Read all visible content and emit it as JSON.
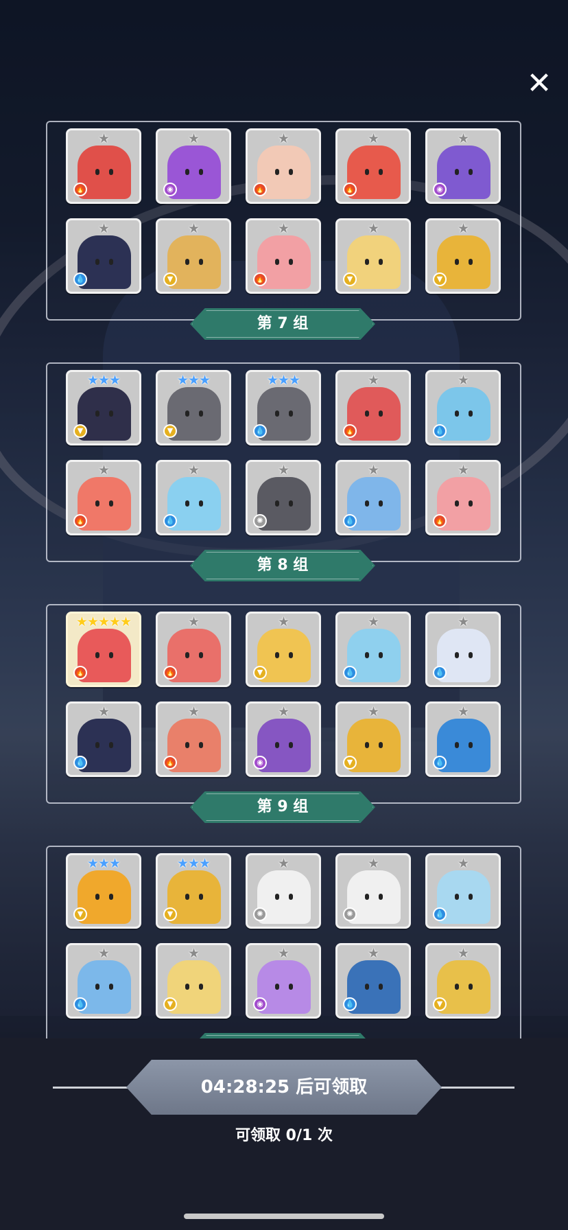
{
  "close_label": "✕",
  "groups": [
    {
      "label": "第 7 组",
      "cards": [
        {
          "stars": 1,
          "star_type": "grey",
          "element": "fire",
          "color": "#e0504a"
        },
        {
          "stars": 1,
          "star_type": "grey",
          "element": "dark",
          "color": "#9a56d6"
        },
        {
          "stars": 1,
          "star_type": "grey",
          "element": "fire",
          "color": "#f2c9b6"
        },
        {
          "stars": 1,
          "star_type": "grey",
          "element": "fire",
          "color": "#e75a4c"
        },
        {
          "stars": 1,
          "star_type": "grey",
          "element": "dark",
          "color": "#7f5ad0"
        },
        {
          "stars": 1,
          "star_type": "grey",
          "element": "water",
          "color": "#2c3154"
        },
        {
          "stars": 1,
          "star_type": "grey",
          "element": "wind",
          "color": "#e2b35c"
        },
        {
          "stars": 1,
          "star_type": "grey",
          "element": "fire",
          "color": "#f2a0a4"
        },
        {
          "stars": 1,
          "star_type": "grey",
          "element": "wind",
          "color": "#f1d27c"
        },
        {
          "stars": 1,
          "star_type": "grey",
          "element": "wind",
          "color": "#e8b43a"
        }
      ]
    },
    {
      "label": "第 8 组",
      "cards": [
        {
          "stars": 3,
          "star_type": "blue",
          "element": "wind",
          "color": "#2f2f4a"
        },
        {
          "stars": 3,
          "star_type": "blue",
          "element": "wind",
          "color": "#6a6a72"
        },
        {
          "stars": 3,
          "star_type": "blue",
          "element": "water",
          "color": "#6a6a72"
        },
        {
          "stars": 1,
          "star_type": "grey",
          "element": "fire",
          "color": "#e05a5a"
        },
        {
          "stars": 1,
          "star_type": "grey",
          "element": "water",
          "color": "#7cc6ea"
        },
        {
          "stars": 1,
          "star_type": "grey",
          "element": "fire",
          "color": "#f07868"
        },
        {
          "stars": 1,
          "star_type": "grey",
          "element": "water",
          "color": "#8ad0f0"
        },
        {
          "stars": 1,
          "star_type": "grey",
          "element": "light",
          "color": "#5a5a62"
        },
        {
          "stars": 1,
          "star_type": "grey",
          "element": "water",
          "color": "#7fb6ea"
        },
        {
          "stars": 1,
          "star_type": "grey",
          "element": "fire",
          "color": "#f2a0a4"
        }
      ]
    },
    {
      "label": "第 9 组",
      "cards": [
        {
          "stars": 5,
          "star_type": "gold",
          "element": "fire",
          "color": "#e85a5a"
        },
        {
          "stars": 1,
          "star_type": "grey",
          "element": "fire",
          "color": "#e9706a"
        },
        {
          "stars": 1,
          "star_type": "grey",
          "element": "wind",
          "color": "#f0c452"
        },
        {
          "stars": 1,
          "star_type": "grey",
          "element": "water",
          "color": "#8fd0ee"
        },
        {
          "stars": 1,
          "star_type": "grey",
          "element": "water",
          "color": "#dfe6f4"
        },
        {
          "stars": 1,
          "star_type": "grey",
          "element": "water",
          "color": "#2c3154"
        },
        {
          "stars": 1,
          "star_type": "grey",
          "element": "fire",
          "color": "#e9806a"
        },
        {
          "stars": 1,
          "star_type": "grey",
          "element": "dark",
          "color": "#8656c2"
        },
        {
          "stars": 1,
          "star_type": "grey",
          "element": "wind",
          "color": "#e8b43a"
        },
        {
          "stars": 1,
          "star_type": "grey",
          "element": "water",
          "color": "#3a8ad8"
        }
      ]
    },
    {
      "label": "",
      "cards": [
        {
          "stars": 3,
          "star_type": "blue",
          "element": "wind",
          "color": "#f0a82c"
        },
        {
          "stars": 3,
          "star_type": "blue",
          "element": "wind",
          "color": "#e8b43a"
        },
        {
          "stars": 1,
          "star_type": "grey",
          "element": "light",
          "color": "#f0f0f0"
        },
        {
          "stars": 1,
          "star_type": "grey",
          "element": "light",
          "color": "#f0f0f0"
        },
        {
          "stars": 1,
          "star_type": "grey",
          "element": "water",
          "color": "#a8d8f0"
        },
        {
          "stars": 1,
          "star_type": "grey",
          "element": "water",
          "color": "#7cb8ea"
        },
        {
          "stars": 1,
          "star_type": "grey",
          "element": "wind",
          "color": "#f0d47a"
        },
        {
          "stars": 1,
          "star_type": "grey",
          "element": "dark",
          "color": "#b78ae6"
        },
        {
          "stars": 1,
          "star_type": "grey",
          "element": "water",
          "color": "#3a72b8"
        },
        {
          "stars": 1,
          "star_type": "grey",
          "element": "wind",
          "color": "#e8c04a"
        }
      ]
    }
  ],
  "element_icons": {
    "fire": "🔥",
    "water": "💧",
    "dark": "◉",
    "wind": "▼",
    "light": "✺"
  },
  "claim": {
    "countdown_text": "04:28:25 后可领取",
    "count_text": "可领取 0/1 次"
  }
}
